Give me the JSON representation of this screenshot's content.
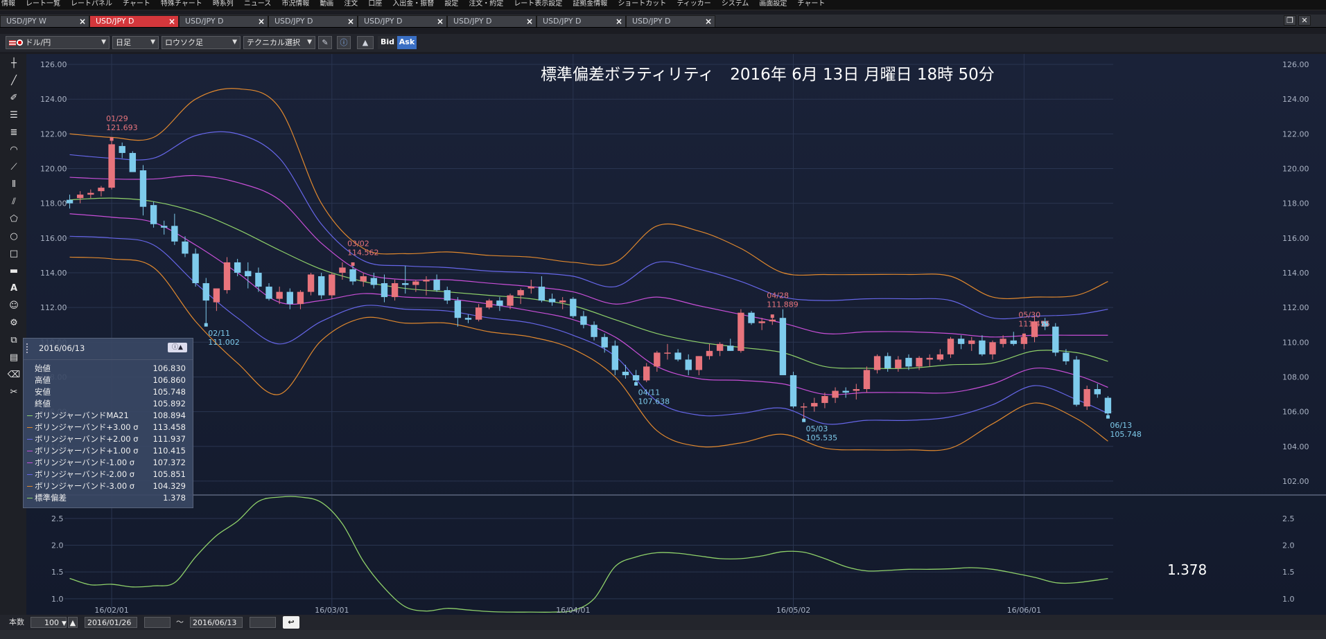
{
  "menu": [
    "情報",
    "レート一覧",
    "レートパネル",
    "チャート",
    "特殊チャート",
    "時系列",
    "ニュース",
    "市況情報",
    "動画",
    "注文",
    "口座",
    "入出金・振替",
    "設定",
    "注文・約定",
    "レート表示設定",
    "証拠金情報",
    "ショートカット",
    "ティッカー",
    "システム",
    "画面設定",
    "チャート"
  ],
  "tabs": [
    {
      "label": "USD/JPY W",
      "active": false
    },
    {
      "label": "USD/JPY D",
      "active": true
    },
    {
      "label": "USD/JPY D",
      "active": false
    },
    {
      "label": "USD/JPY D",
      "active": false
    },
    {
      "label": "USD/JPY D",
      "active": false
    },
    {
      "label": "USD/JPY D",
      "active": false
    },
    {
      "label": "USD/JPY D",
      "active": false
    },
    {
      "label": "USD/JPY D",
      "active": false
    }
  ],
  "toolbar": {
    "pair": "ドル/円",
    "period": "日足",
    "chart_kind": "ロウソク足",
    "technical": "テクニカル選択",
    "bid": "Bid",
    "ask": "Ask"
  },
  "chart_title": "標準偏差ボラティリティ　2016年 6月 13日 月曜日 18時 50分",
  "info_panel": {
    "date": "2016/06/13",
    "rows": [
      {
        "label": "始値",
        "value": "106.830"
      },
      {
        "label": "高値",
        "value": "106.860"
      },
      {
        "label": "安値",
        "value": "105.748"
      },
      {
        "label": "終値",
        "value": "105.892"
      },
      {
        "label": "ボリンジャーバンドMA21",
        "value": "108.894",
        "color": "#8fd16a"
      },
      {
        "label": "ボリンジャーバンド+3.00 σ",
        "value": "113.458",
        "color": "#e0882e"
      },
      {
        "label": "ボリンジャーバンド+2.00 σ",
        "value": "111.937",
        "color": "#6666e8"
      },
      {
        "label": "ボリンジャーバンド+1.00 σ",
        "value": "110.415",
        "color": "#c84fd8"
      },
      {
        "label": "ボリンジャーバンド-1.00 σ",
        "value": "107.372",
        "color": "#c84fd8"
      },
      {
        "label": "ボリンジャーバンド-2.00 σ",
        "value": "105.851",
        "color": "#6666e8"
      },
      {
        "label": "ボリンジャーバンド-3.00 σ",
        "value": "104.329",
        "color": "#e0882e"
      },
      {
        "label": "標準偏差",
        "value": "1.378",
        "color": "#8fd16a"
      }
    ]
  },
  "bottom": {
    "count_label": "本数",
    "count_value": "100",
    "date_from": "2016/01/26",
    "tilde": "～",
    "date_to": "2016/06/13"
  },
  "colors": {
    "up": "#e8747c",
    "down": "#7ecbec",
    "ma": "#8fd16a",
    "sigma3": "#e0882e",
    "sigma2": "#6666e8",
    "sigma1": "#c84fd8",
    "sd": "#8fd16a",
    "bg": "#172035"
  },
  "chart_data": [
    {
      "type": "candlestick",
      "title": "標準偏差ボラティリティ　2016年 6月 13日 月曜日 18時 50分",
      "y_ticks": [
        "126.00",
        "124.00",
        "122.00",
        "120.00",
        "118.00",
        "116.00",
        "114.00",
        "112.00",
        "110.00",
        "108.00",
        "106.00",
        "104.00",
        "102.00"
      ],
      "ylim": [
        101.2,
        126.6
      ],
      "x_ticks": [
        {
          "i": 4,
          "label": "16/02/01"
        },
        {
          "i": 25,
          "label": "16/03/01"
        },
        {
          "i": 48,
          "label": "16/04/01"
        },
        {
          "i": 69,
          "label": "16/05/02"
        },
        {
          "i": 91,
          "label": "16/06/01"
        }
      ],
      "x_count": 100,
      "candles": [
        [
          118.2,
          118.5,
          117.7,
          118.0
        ],
        [
          118.3,
          118.7,
          118.0,
          118.5
        ],
        [
          118.5,
          118.8,
          118.3,
          118.6
        ],
        [
          118.7,
          119.0,
          118.4,
          118.9
        ],
        [
          118.9,
          121.7,
          118.8,
          121.4
        ],
        [
          121.3,
          121.5,
          120.6,
          120.9
        ],
        [
          120.9,
          121.0,
          119.9,
          119.8
        ],
        [
          119.9,
          120.2,
          117.3,
          117.8
        ],
        [
          117.9,
          118.1,
          116.6,
          116.8
        ],
        [
          116.7,
          117.0,
          116.2,
          116.6
        ],
        [
          116.7,
          117.4,
          115.6,
          115.8
        ],
        [
          115.8,
          116.1,
          114.9,
          115.1
        ],
        [
          115.1,
          115.4,
          113.2,
          113.4
        ],
        [
          113.4,
          113.7,
          111.0,
          112.4
        ],
        [
          112.3,
          113.0,
          111.8,
          113.1
        ],
        [
          113.0,
          114.9,
          112.8,
          114.6
        ],
        [
          114.6,
          114.8,
          113.8,
          114.0
        ],
        [
          114.1,
          114.6,
          113.1,
          113.8
        ],
        [
          114.0,
          114.3,
          112.9,
          113.2
        ],
        [
          113.2,
          113.4,
          112.4,
          112.5
        ],
        [
          112.5,
          113.2,
          112.2,
          112.9
        ],
        [
          112.9,
          113.1,
          111.9,
          112.2
        ],
        [
          112.2,
          113.0,
          111.9,
          112.9
        ],
        [
          112.9,
          114.0,
          112.7,
          113.9
        ],
        [
          113.8,
          114.0,
          112.5,
          112.7
        ],
        [
          112.7,
          114.0,
          112.5,
          113.9
        ],
        [
          114.0,
          114.6,
          113.6,
          114.3
        ],
        [
          114.2,
          114.5,
          113.3,
          113.5
        ],
        [
          113.5,
          114.0,
          113.2,
          113.8
        ],
        [
          113.7,
          114.0,
          113.1,
          113.3
        ],
        [
          113.4,
          113.9,
          112.3,
          112.6
        ],
        [
          112.6,
          113.6,
          112.4,
          113.4
        ],
        [
          113.4,
          114.4,
          112.8,
          113.3
        ],
        [
          113.3,
          113.6,
          112.9,
          113.5
        ],
        [
          113.5,
          113.8,
          112.7,
          113.6
        ],
        [
          113.6,
          113.9,
          112.9,
          113.0
        ],
        [
          113.0,
          113.2,
          112.2,
          112.4
        ],
        [
          112.4,
          112.6,
          110.9,
          111.4
        ],
        [
          111.4,
          111.6,
          111.1,
          111.3
        ],
        [
          111.3,
          112.2,
          111.2,
          112.0
        ],
        [
          112.0,
          112.5,
          111.9,
          112.4
        ],
        [
          112.4,
          112.6,
          111.8,
          112.1
        ],
        [
          112.1,
          112.8,
          111.9,
          112.7
        ],
        [
          112.7,
          113.1,
          112.2,
          113.0
        ],
        [
          113.1,
          113.6,
          112.8,
          113.2
        ],
        [
          113.2,
          113.8,
          112.3,
          112.4
        ],
        [
          112.5,
          112.8,
          112.1,
          112.3
        ],
        [
          112.3,
          112.6,
          111.9,
          112.4
        ],
        [
          112.5,
          112.6,
          111.4,
          111.5
        ],
        [
          111.5,
          111.8,
          110.8,
          111.0
        ],
        [
          111.0,
          111.2,
          110.1,
          110.3
        ],
        [
          110.3,
          110.5,
          109.4,
          109.7
        ],
        [
          109.8,
          110.1,
          108.1,
          108.4
        ],
        [
          108.3,
          108.7,
          107.9,
          108.1
        ],
        [
          108.1,
          108.4,
          107.6,
          107.8
        ],
        [
          107.8,
          108.8,
          107.7,
          108.6
        ],
        [
          108.6,
          109.5,
          108.3,
          109.4
        ],
        [
          109.4,
          109.9,
          109.0,
          109.4
        ],
        [
          109.4,
          109.6,
          108.9,
          109.0
        ],
        [
          109.0,
          109.3,
          108.1,
          108.4
        ],
        [
          108.4,
          109.2,
          108.1,
          109.2
        ],
        [
          109.2,
          109.9,
          109.0,
          109.5
        ],
        [
          109.5,
          110.0,
          109.2,
          109.9
        ],
        [
          109.8,
          110.2,
          109.5,
          109.5
        ],
        [
          109.5,
          111.9,
          109.4,
          111.7
        ],
        [
          111.7,
          111.8,
          111.0,
          111.1
        ],
        [
          111.1,
          111.4,
          110.7,
          111.2
        ],
        [
          111.2,
          111.5,
          111.0,
          111.3
        ],
        [
          111.4,
          111.9,
          109.1,
          108.1
        ],
        [
          108.1,
          108.3,
          106.2,
          106.3
        ],
        [
          106.3,
          106.5,
          105.5,
          106.3
        ],
        [
          106.3,
          106.8,
          106.0,
          106.5
        ],
        [
          106.5,
          107.1,
          106.2,
          106.9
        ],
        [
          106.8,
          107.4,
          106.5,
          107.2
        ],
        [
          107.2,
          107.4,
          106.8,
          107.1
        ],
        [
          107.2,
          107.6,
          106.7,
          107.3
        ],
        [
          107.3,
          108.6,
          107.1,
          108.4
        ],
        [
          108.4,
          109.3,
          108.2,
          109.2
        ],
        [
          109.2,
          109.4,
          108.3,
          108.5
        ],
        [
          108.5,
          109.2,
          108.3,
          109.0
        ],
        [
          109.1,
          109.3,
          108.4,
          108.6
        ],
        [
          108.6,
          109.2,
          108.4,
          109.1
        ],
        [
          109.0,
          109.3,
          108.6,
          109.1
        ],
        [
          109.0,
          109.6,
          108.9,
          109.3
        ],
        [
          109.3,
          110.3,
          109.1,
          110.2
        ],
        [
          110.2,
          110.4,
          109.6,
          109.9
        ],
        [
          109.9,
          110.3,
          109.5,
          110.1
        ],
        [
          110.1,
          110.4,
          109.2,
          109.3
        ],
        [
          109.3,
          110.1,
          109.0,
          110.0
        ],
        [
          109.9,
          110.4,
          109.7,
          110.2
        ],
        [
          110.1,
          110.6,
          109.8,
          109.9
        ],
        [
          109.9,
          110.4,
          109.6,
          110.3
        ],
        [
          110.3,
          111.5,
          110.0,
          111.2
        ],
        [
          111.2,
          111.4,
          110.7,
          110.9
        ],
        [
          110.9,
          111.1,
          109.2,
          109.4
        ],
        [
          109.4,
          109.6,
          108.7,
          108.9
        ],
        [
          109.0,
          109.2,
          106.3,
          106.4
        ],
        [
          106.3,
          107.5,
          106.1,
          107.3
        ],
        [
          107.3,
          107.6,
          106.8,
          107.0
        ],
        [
          106.8,
          106.9,
          105.7,
          105.9
        ]
      ],
      "markers": [
        {
          "i": 4,
          "date": "01/29",
          "price": "121.693",
          "pos": "above"
        },
        {
          "i": 13,
          "date": "02/11",
          "price": "111.002",
          "pos": "below"
        },
        {
          "i": 27,
          "date": "03/02",
          "price": "114.562",
          "pos": "above"
        },
        {
          "i": 54,
          "date": "04/11",
          "price": "107.638",
          "pos": "below"
        },
        {
          "i": 67,
          "date": "04/28",
          "price": "111.889",
          "pos": "above"
        },
        {
          "i": 70,
          "date": "05/03",
          "price": "105.535",
          "pos": "below"
        },
        {
          "i": 91,
          "date": "05/30",
          "price": "111.455",
          "pos": "above"
        },
        {
          "i": 99,
          "date": "06/13",
          "price": "105.748",
          "pos": "below"
        }
      ],
      "bands": {
        "x": [
          0,
          4,
          8,
          12,
          16,
          20,
          24,
          28,
          32,
          36,
          40,
          44,
          48,
          52,
          56,
          60,
          64,
          68,
          72,
          76,
          80,
          84,
          88,
          92,
          96,
          99
        ],
        "ma": [
          118.2,
          118.3,
          118.1,
          117.5,
          116.5,
          115.3,
          114.2,
          113.5,
          113.1,
          112.9,
          112.7,
          112.5,
          112.1,
          111.3,
          110.5,
          110.0,
          109.7,
          109.4,
          108.6,
          108.5,
          108.5,
          108.7,
          108.8,
          109.5,
          109.4,
          108.9
        ],
        "p3": [
          122.0,
          121.8,
          121.8,
          124.0,
          124.6,
          123.5,
          118.0,
          115.4,
          115.1,
          115.2,
          115.0,
          114.9,
          114.6,
          114.6,
          116.7,
          116.4,
          115.4,
          114.0,
          113.9,
          113.9,
          113.9,
          113.8,
          112.6,
          112.6,
          112.7,
          113.5
        ],
        "p2": [
          120.8,
          120.6,
          120.6,
          121.9,
          122.0,
          120.6,
          116.8,
          114.7,
          114.4,
          114.3,
          114.1,
          114.0,
          113.8,
          113.2,
          114.6,
          114.2,
          113.5,
          112.6,
          112.4,
          112.5,
          112.5,
          112.4,
          111.4,
          111.5,
          111.6,
          111.9
        ],
        "p1": [
          119.5,
          119.4,
          119.4,
          119.6,
          119.2,
          118.2,
          115.7,
          114.0,
          113.6,
          113.6,
          113.4,
          113.2,
          112.9,
          112.2,
          112.6,
          112.1,
          111.6,
          111.1,
          110.5,
          110.6,
          110.6,
          110.5,
          110.3,
          110.4,
          110.4,
          110.4
        ],
        "m1": [
          117.4,
          117.2,
          116.9,
          115.6,
          114.0,
          112.3,
          112.4,
          112.8,
          112.6,
          112.5,
          112.2,
          111.8,
          111.3,
          110.3,
          108.6,
          107.9,
          107.8,
          107.6,
          107.0,
          107.1,
          107.1,
          107.1,
          107.6,
          108.5,
          108.1,
          107.4
        ],
        "m2": [
          116.1,
          116.0,
          115.6,
          113.4,
          111.4,
          109.9,
          111.2,
          112.1,
          111.9,
          111.8,
          111.4,
          111.1,
          110.4,
          109.2,
          106.6,
          105.8,
          105.9,
          106.2,
          105.3,
          105.5,
          105.5,
          105.7,
          106.4,
          107.5,
          106.7,
          105.9
        ],
        "m3": [
          114.9,
          114.8,
          114.3,
          111.2,
          108.8,
          107.0,
          110.1,
          111.4,
          111.1,
          111.1,
          110.6,
          110.3,
          109.6,
          108.0,
          104.9,
          104.0,
          104.2,
          104.7,
          103.9,
          103.8,
          103.8,
          103.9,
          105.3,
          106.5,
          105.6,
          104.3
        ]
      }
    },
    {
      "type": "line",
      "y_ticks": [
        "2.5",
        "2.0",
        "1.5",
        "1.0"
      ],
      "ylim": [
        0.7,
        2.9
      ],
      "x": [
        0,
        2,
        4,
        6,
        8,
        10,
        12,
        14,
        16,
        18,
        20,
        22,
        24,
        26,
        28,
        30,
        32,
        34,
        36,
        38,
        40,
        42,
        44,
        46,
        48,
        50,
        52,
        54,
        56,
        58,
        60,
        62,
        64,
        66,
        68,
        70,
        72,
        74,
        76,
        78,
        80,
        82,
        84,
        86,
        88,
        90,
        92,
        94,
        96,
        99
      ],
      "series": [
        {
          "values": [
            1.38,
            1.26,
            1.27,
            1.22,
            1.24,
            1.3,
            1.78,
            2.18,
            2.45,
            2.82,
            2.9,
            2.9,
            2.8,
            2.4,
            1.7,
            1.2,
            0.85,
            0.77,
            0.82,
            0.79,
            0.76,
            0.75,
            0.75,
            0.75,
            0.78,
            1.0,
            1.6,
            1.78,
            1.86,
            1.85,
            1.8,
            1.75,
            1.75,
            1.8,
            1.88,
            1.87,
            1.75,
            1.6,
            1.52,
            1.53,
            1.55,
            1.55,
            1.56,
            1.58,
            1.55,
            1.48,
            1.4,
            1.3,
            1.3,
            1.378
          ]
        }
      ],
      "last_value": "1.378"
    }
  ]
}
